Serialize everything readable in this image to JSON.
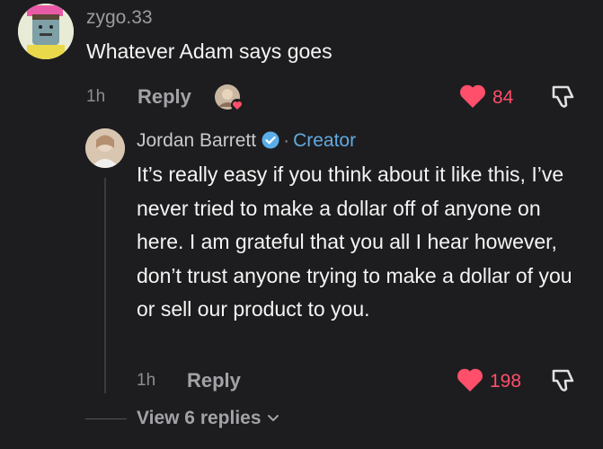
{
  "comment": {
    "username": "zygo.33",
    "text": "Whatever Adam says goes",
    "time": "1h",
    "reply_label": "Reply",
    "likes": "84"
  },
  "reply": {
    "author": "Jordan Barrett",
    "separator": "·",
    "role": "Creator",
    "text": "It’s really easy if you think about it like this, I’ve never tried to make a dollar off of anyone on here. I am grateful that you all I hear however, don’t trust anyone trying to make a dollar of you or sell our product to you.",
    "time": "1h",
    "reply_label": "Reply",
    "likes": "198"
  },
  "view_replies": "View 6 replies",
  "colors": {
    "like": "#ff4f6a",
    "creator": "#63a9e0",
    "background": "#1d1d1f"
  },
  "icons": [
    "heart-icon",
    "dislike-icon",
    "verified-badge-icon",
    "chevron-down-icon"
  ]
}
